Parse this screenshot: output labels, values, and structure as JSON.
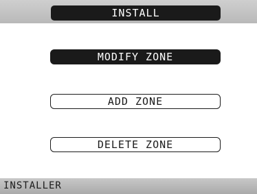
{
  "header": {
    "title": "INSTALL"
  },
  "menu": {
    "items": [
      {
        "label": "MODIFY ZONE",
        "selected": true
      },
      {
        "label": "ADD ZONE",
        "selected": false
      },
      {
        "label": "DELETE ZONE",
        "selected": false
      }
    ]
  },
  "status_bar": {
    "text": "INSTALLER"
  },
  "colors": {
    "panel_dark": "#1a1a1a",
    "background": "#ffffff",
    "bar_gray": "#b9b9b9"
  }
}
